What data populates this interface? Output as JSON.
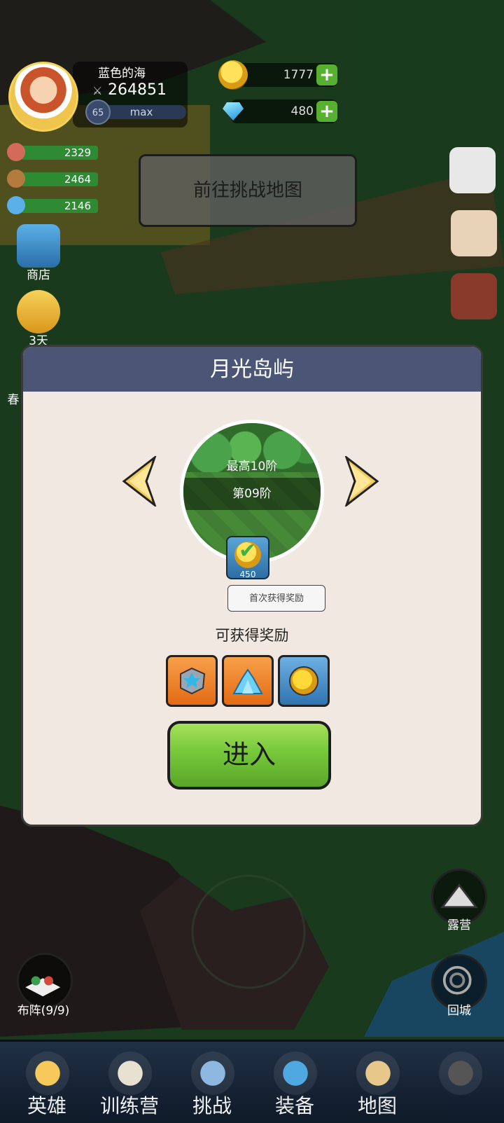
{
  "player": {
    "name": "蓝色的海",
    "power": "264851",
    "level": "65",
    "exp_label": "max"
  },
  "currency": {
    "gold": "1777",
    "gems": "480"
  },
  "resources": [
    {
      "value": "2329",
      "icon": "meat-icon"
    },
    {
      "value": "2464",
      "icon": "wood-icon"
    },
    {
      "value": "2146",
      "icon": "crystal-icon"
    }
  ],
  "left_menu": {
    "shop": "商店",
    "pass": "3天",
    "spring": "春"
  },
  "challenge_hint": "前往挑战地图",
  "modal": {
    "title": "月光岛屿",
    "max_tier": "最高10阶",
    "current_tier": "第09阶",
    "first_reward_amount": "450",
    "first_reward_tip": "首次获得奖励",
    "rewards_title": "可获得奖励",
    "rewards": [
      "ore-stone-icon",
      "crystal-pile-icon",
      "gold-coin-icon"
    ],
    "enter_label": "进入"
  },
  "map_buttons": {
    "camp": "露营",
    "return_city": "回城",
    "formation": "布阵(9/9)"
  },
  "bottom_nav": [
    {
      "label": "英雄",
      "icon": "heroes-icon"
    },
    {
      "label": "训练营",
      "icon": "training-camp-icon"
    },
    {
      "label": "挑战",
      "icon": "challenge-sword-icon"
    },
    {
      "label": "装备",
      "icon": "equipment-icon"
    },
    {
      "label": "地图",
      "icon": "map-scroll-icon"
    },
    {
      "label": "",
      "icon": "locked-icon"
    }
  ],
  "colors": {
    "modal_header": "#4b5576",
    "modal_body": "#f1e9e1",
    "enter_button": "#76c83a",
    "resource_bar": "#2f8a34"
  }
}
